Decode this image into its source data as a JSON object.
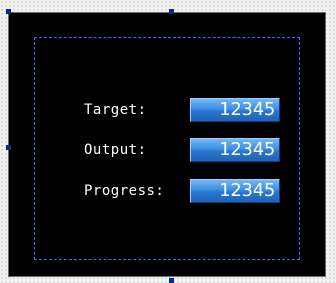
{
  "panel": {
    "rows": [
      {
        "label": "Target:",
        "value": "12345"
      },
      {
        "label": "Output:",
        "value": "12345"
      },
      {
        "label": "Progress:",
        "value": "12345"
      }
    ]
  },
  "colors": {
    "background": "#000000",
    "value_box_accent": "#3d8ee3",
    "selection_border": "#3a6bff",
    "handle": "#0a2a8a"
  }
}
